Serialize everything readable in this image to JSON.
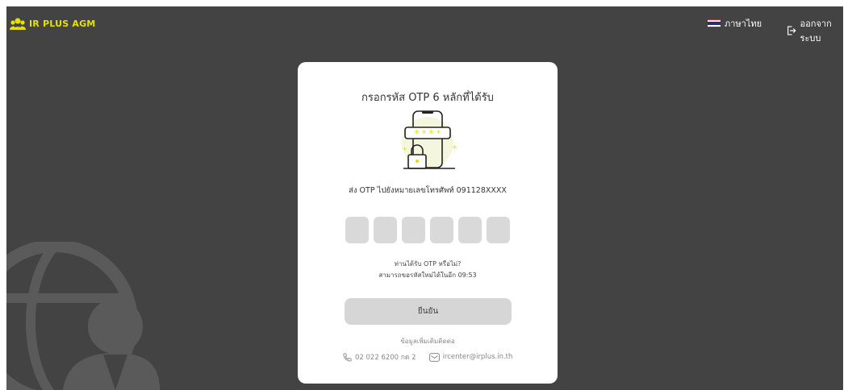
{
  "brand": {
    "name": "IR PLUS AGM",
    "logo_icon": "user-group-icon",
    "color": "#e6e000"
  },
  "header": {
    "language_label": "ภาษาไทย",
    "language_icon": "thai-flag-icon",
    "logout_label": "ออกจากระบบ",
    "logout_icon": "logout-icon"
  },
  "otp_card": {
    "title": "กรอกรหัส OTP 6 หลักที่ได้รับ",
    "sent_message": "ส่ง OTP ไปยังหมายเลขโทรศัพท์ 091128XXXX",
    "digits": [
      "",
      "",
      "",
      "",
      "",
      ""
    ],
    "not_received": "ท่านได้รับ OTP หรือไม่?",
    "resend_countdown": "สามารถขอรหัสใหม่ได้ในอีก 09:53",
    "confirm_label": "ยืนยัน",
    "more_info": "ข้อมูลเพิ่มเติมติดต่อ",
    "phone": "02 022 6200 กด 2",
    "email": "ircenter@irplus.in.th"
  },
  "colors": {
    "background": "#434343",
    "card": "#ffffff",
    "otp_box": "#d9d9d9",
    "button": "#d6d6d6"
  }
}
